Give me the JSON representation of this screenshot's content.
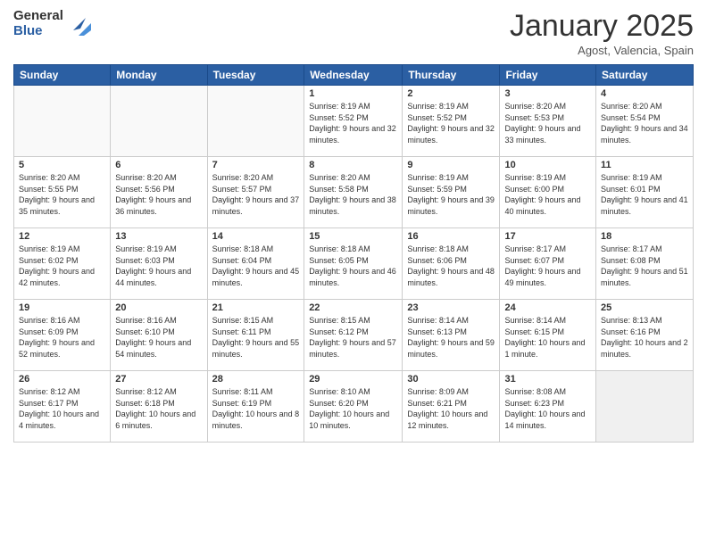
{
  "header": {
    "logo_general": "General",
    "logo_blue": "Blue",
    "month_year": "January 2025",
    "location": "Agost, Valencia, Spain"
  },
  "days_of_week": [
    "Sunday",
    "Monday",
    "Tuesday",
    "Wednesday",
    "Thursday",
    "Friday",
    "Saturday"
  ],
  "weeks": [
    [
      {
        "day": "",
        "info": ""
      },
      {
        "day": "",
        "info": ""
      },
      {
        "day": "",
        "info": ""
      },
      {
        "day": "1",
        "info": "Sunrise: 8:19 AM\nSunset: 5:52 PM\nDaylight: 9 hours and 32 minutes."
      },
      {
        "day": "2",
        "info": "Sunrise: 8:19 AM\nSunset: 5:52 PM\nDaylight: 9 hours and 32 minutes."
      },
      {
        "day": "3",
        "info": "Sunrise: 8:20 AM\nSunset: 5:53 PM\nDaylight: 9 hours and 33 minutes."
      },
      {
        "day": "4",
        "info": "Sunrise: 8:20 AM\nSunset: 5:54 PM\nDaylight: 9 hours and 34 minutes."
      }
    ],
    [
      {
        "day": "5",
        "info": "Sunrise: 8:20 AM\nSunset: 5:55 PM\nDaylight: 9 hours and 35 minutes."
      },
      {
        "day": "6",
        "info": "Sunrise: 8:20 AM\nSunset: 5:56 PM\nDaylight: 9 hours and 36 minutes."
      },
      {
        "day": "7",
        "info": "Sunrise: 8:20 AM\nSunset: 5:57 PM\nDaylight: 9 hours and 37 minutes."
      },
      {
        "day": "8",
        "info": "Sunrise: 8:20 AM\nSunset: 5:58 PM\nDaylight: 9 hours and 38 minutes."
      },
      {
        "day": "9",
        "info": "Sunrise: 8:19 AM\nSunset: 5:59 PM\nDaylight: 9 hours and 39 minutes."
      },
      {
        "day": "10",
        "info": "Sunrise: 8:19 AM\nSunset: 6:00 PM\nDaylight: 9 hours and 40 minutes."
      },
      {
        "day": "11",
        "info": "Sunrise: 8:19 AM\nSunset: 6:01 PM\nDaylight: 9 hours and 41 minutes."
      }
    ],
    [
      {
        "day": "12",
        "info": "Sunrise: 8:19 AM\nSunset: 6:02 PM\nDaylight: 9 hours and 42 minutes."
      },
      {
        "day": "13",
        "info": "Sunrise: 8:19 AM\nSunset: 6:03 PM\nDaylight: 9 hours and 44 minutes."
      },
      {
        "day": "14",
        "info": "Sunrise: 8:18 AM\nSunset: 6:04 PM\nDaylight: 9 hours and 45 minutes."
      },
      {
        "day": "15",
        "info": "Sunrise: 8:18 AM\nSunset: 6:05 PM\nDaylight: 9 hours and 46 minutes."
      },
      {
        "day": "16",
        "info": "Sunrise: 8:18 AM\nSunset: 6:06 PM\nDaylight: 9 hours and 48 minutes."
      },
      {
        "day": "17",
        "info": "Sunrise: 8:17 AM\nSunset: 6:07 PM\nDaylight: 9 hours and 49 minutes."
      },
      {
        "day": "18",
        "info": "Sunrise: 8:17 AM\nSunset: 6:08 PM\nDaylight: 9 hours and 51 minutes."
      }
    ],
    [
      {
        "day": "19",
        "info": "Sunrise: 8:16 AM\nSunset: 6:09 PM\nDaylight: 9 hours and 52 minutes."
      },
      {
        "day": "20",
        "info": "Sunrise: 8:16 AM\nSunset: 6:10 PM\nDaylight: 9 hours and 54 minutes."
      },
      {
        "day": "21",
        "info": "Sunrise: 8:15 AM\nSunset: 6:11 PM\nDaylight: 9 hours and 55 minutes."
      },
      {
        "day": "22",
        "info": "Sunrise: 8:15 AM\nSunset: 6:12 PM\nDaylight: 9 hours and 57 minutes."
      },
      {
        "day": "23",
        "info": "Sunrise: 8:14 AM\nSunset: 6:13 PM\nDaylight: 9 hours and 59 minutes."
      },
      {
        "day": "24",
        "info": "Sunrise: 8:14 AM\nSunset: 6:15 PM\nDaylight: 10 hours and 1 minute."
      },
      {
        "day": "25",
        "info": "Sunrise: 8:13 AM\nSunset: 6:16 PM\nDaylight: 10 hours and 2 minutes."
      }
    ],
    [
      {
        "day": "26",
        "info": "Sunrise: 8:12 AM\nSunset: 6:17 PM\nDaylight: 10 hours and 4 minutes."
      },
      {
        "day": "27",
        "info": "Sunrise: 8:12 AM\nSunset: 6:18 PM\nDaylight: 10 hours and 6 minutes."
      },
      {
        "day": "28",
        "info": "Sunrise: 8:11 AM\nSunset: 6:19 PM\nDaylight: 10 hours and 8 minutes."
      },
      {
        "day": "29",
        "info": "Sunrise: 8:10 AM\nSunset: 6:20 PM\nDaylight: 10 hours and 10 minutes."
      },
      {
        "day": "30",
        "info": "Sunrise: 8:09 AM\nSunset: 6:21 PM\nDaylight: 10 hours and 12 minutes."
      },
      {
        "day": "31",
        "info": "Sunrise: 8:08 AM\nSunset: 6:23 PM\nDaylight: 10 hours and 14 minutes."
      },
      {
        "day": "",
        "info": ""
      }
    ]
  ]
}
